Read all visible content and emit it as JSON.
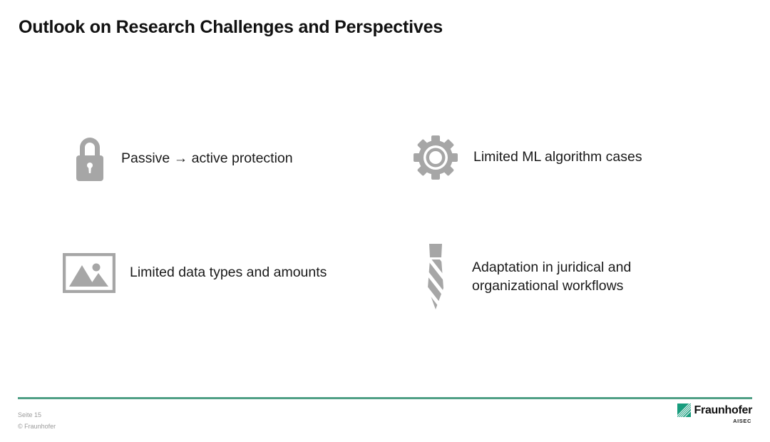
{
  "slide": {
    "title": "Outlook on Research Challenges and Perspectives",
    "background_color": "#ffffff",
    "icon_color": "#a6a6a6",
    "accent_color": "#4f9f85"
  },
  "items": [
    {
      "icon": "lock-icon",
      "label": "Passive → active protection"
    },
    {
      "icon": "gear-icon",
      "label": "Limited ML algorithm cases"
    },
    {
      "icon": "picture-icon",
      "label": "Limited data types and amounts"
    },
    {
      "icon": "necktie-icon",
      "label": "Adaptation in juridical and\norganizational workflows"
    }
  ],
  "footer": {
    "page_label": "Seite 15",
    "copyright": "© Fraunhofer",
    "logo_word": "Fraunhofer",
    "logo_sub": "AISEC"
  }
}
